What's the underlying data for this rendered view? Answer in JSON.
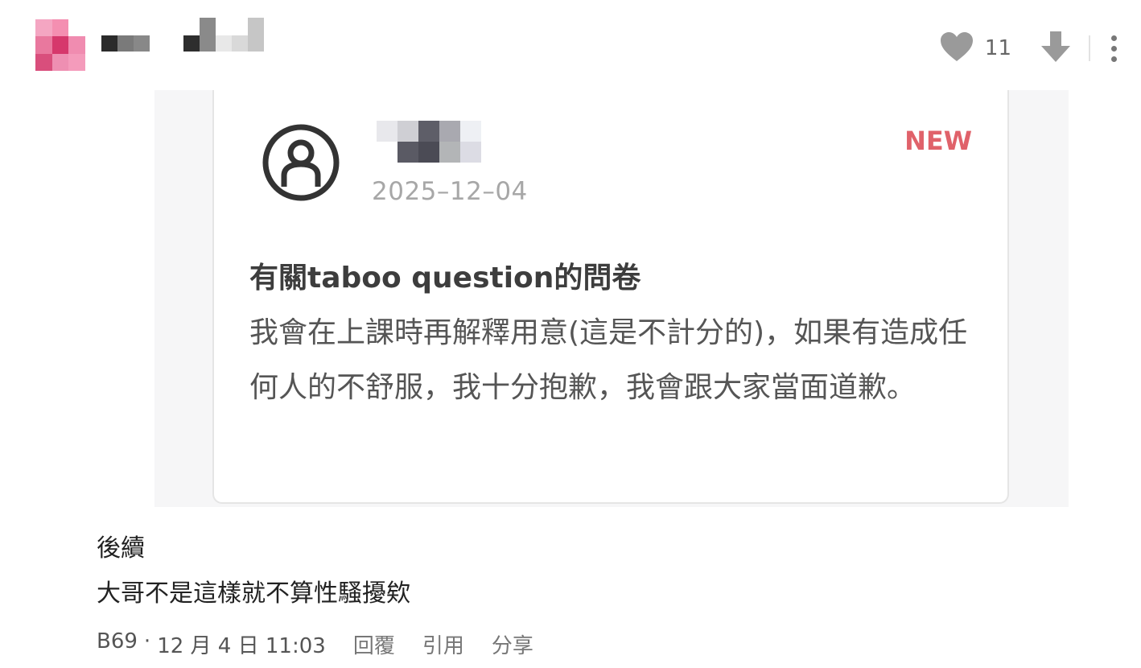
{
  "comment": {
    "like_count": "11",
    "icons": {
      "like": "heart-icon",
      "dislike": "arrow-down-icon",
      "more": "more-vertical-icon"
    },
    "embed": {
      "date": "2025–12–04",
      "badge": "NEW",
      "title": "有關taboo question的問卷",
      "body": "我會在上課時再解釋用意(這是不計分的)，如果有造成任何人的不舒服，我十分抱歉，我會跟大家當面道歉。"
    },
    "lines": [
      "後續",
      "大哥不是這樣就不算性騷擾欸"
    ],
    "meta": {
      "floor": "B69",
      "separator": "·",
      "time": "12 月 4 日 11:03",
      "reply": "回覆",
      "quote": "引用",
      "share": "分享"
    }
  },
  "colors": {
    "badge": "#e0626a",
    "date": "#a7a7a7",
    "icon_gray": "#9a9a9a"
  }
}
